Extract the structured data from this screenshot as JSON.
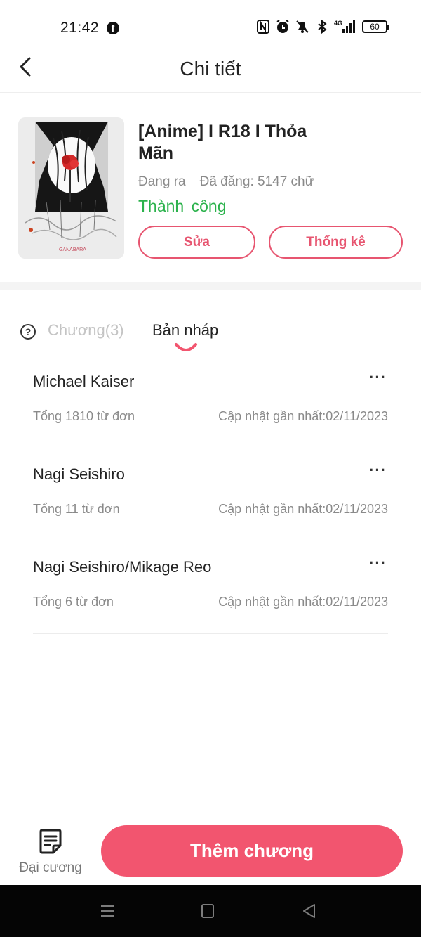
{
  "status_bar": {
    "time": "21:42",
    "app_notification": "f",
    "battery": "60",
    "icons": [
      "nfc-icon",
      "alarm-icon",
      "mute-icon",
      "bluetooth-icon",
      "signal-4g-icon"
    ]
  },
  "header": {
    "title": "Chi tiết"
  },
  "book": {
    "title": "[Anime] I R18 I Thỏa Mãn",
    "status": "Đang ra",
    "word_count": "Đã đăng: 5147 chữ",
    "review_status": "Thành công",
    "edit_label": "Sửa",
    "stats_label": "Thống kê"
  },
  "tabs": {
    "help_symbol": "?",
    "chapters": "Chương(3)",
    "drafts": "Bản nháp",
    "active": "drafts"
  },
  "drafts": [
    {
      "title": "Michael Kaiser",
      "total": "Tổng 1810 từ đơn",
      "updated": "Cập nhật gần nhất:02/11/2023",
      "more": "···"
    },
    {
      "title": "Nagi Seishiro",
      "total": "Tổng 11 từ đơn",
      "updated": "Cập nhật gần nhất:02/11/2023",
      "more": "···"
    },
    {
      "title": "Nagi Seishiro/Mikage Reo",
      "total": "Tổng 6 từ đơn",
      "updated": "Cập nhật gần nhất:02/11/2023",
      "more": "···"
    }
  ],
  "bottom": {
    "outline_label": "Đại cương",
    "add_chapter_label": "Thêm chương"
  },
  "colors": {
    "accent": "#f2556f",
    "success": "#2bb24c",
    "muted_text": "#8a8a8a"
  }
}
